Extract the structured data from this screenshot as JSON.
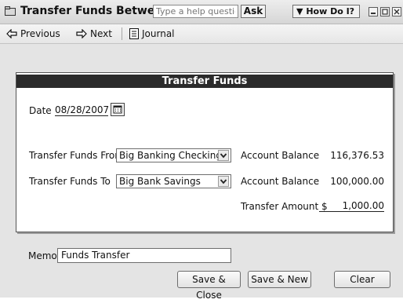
{
  "window": {
    "title": "Transfer Funds Between Accounts",
    "help_placeholder": "Type a help question",
    "ask_label": "Ask",
    "how_do_i_label": "How Do I?"
  },
  "toolbar": {
    "previous_label": "Previous",
    "next_label": "Next",
    "journal_label": "Journal"
  },
  "form": {
    "header": "Transfer Funds",
    "date_label": "Date",
    "date_value": "08/28/2007",
    "from_label": "Transfer Funds From",
    "from_value": "Big Banking Checking",
    "from_balance_label": "Account Balance",
    "from_balance_value": "116,376.53",
    "to_label": "Transfer Funds To",
    "to_value": "Big Bank Savings",
    "to_balance_label": "Account Balance",
    "to_balance_value": "100,000.00",
    "amount_label": "Transfer Amount $",
    "amount_value": "1,000.00"
  },
  "memo": {
    "label": "Memo",
    "value": "Funds Transfer"
  },
  "buttons": {
    "save_close": "Save & Close",
    "save_new": "Save & New",
    "clear": "Clear"
  }
}
